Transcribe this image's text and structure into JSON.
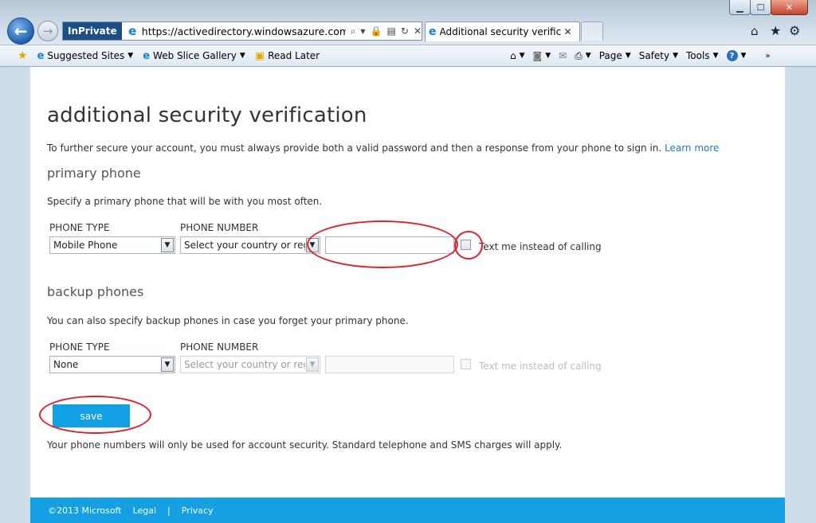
{
  "browser": {
    "inprivate_label": "InPrivate",
    "url": "https://activedirectory.windowsazure.com/Additior",
    "tab_title": "Additional security verificat...",
    "favorites": [
      {
        "label": "Suggested Sites"
      },
      {
        "label": "Web Slice Gallery"
      },
      {
        "label": "Read Later"
      }
    ],
    "commands": {
      "page": "Page",
      "safety": "Safety",
      "tools": "Tools"
    },
    "accent_color": "#1d4f87"
  },
  "page": {
    "title": "additional security verification",
    "intro_text": "To further secure your account, you must always provide both a valid password and then a response from your phone to sign in.",
    "learn_more": "Learn more",
    "primary": {
      "heading": "primary phone",
      "description": "Specify a primary phone that will be with you most often.",
      "phone_type_label": "PHONE TYPE",
      "phone_number_label": "PHONE NUMBER",
      "phone_type_value": "Mobile Phone",
      "country_value": "Select your country or region",
      "number_value": "",
      "text_me_label": "Text me instead of calling"
    },
    "backup": {
      "heading": "backup phones",
      "description": "You can also specify backup phones in case you forget your primary phone.",
      "phone_type_label": "PHONE TYPE",
      "phone_number_label": "PHONE NUMBER",
      "phone_type_value": "None",
      "country_value": "Select your country or region",
      "number_value": "",
      "text_me_label": "Text me instead of calling"
    },
    "save_label": "save",
    "disclaimer": "Your phone numbers will only be used for account security. Standard telephone and SMS charges will apply.",
    "footer": {
      "copyright": "©2013 Microsoft",
      "legal": "Legal",
      "separator": "|",
      "privacy": "Privacy"
    },
    "accent_color": "#12a0e4",
    "annotation_color": "#d9232d"
  }
}
